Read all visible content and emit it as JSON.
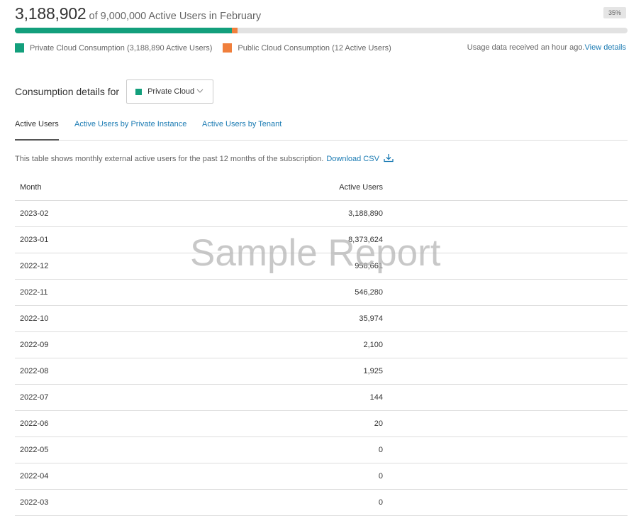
{
  "header": {
    "active_count": "3,188,902",
    "summary": "of 9,000,000 Active Users in February",
    "percent_badge": "35%"
  },
  "progress": {
    "private_fraction": 0.3543,
    "public_fraction": 0.0095,
    "private_color": "#139f7c",
    "public_color": "#f07f3c"
  },
  "legend": {
    "private_label": "Private Cloud Consumption (3,188,890 Active Users)",
    "public_label": "Public Cloud Consumption (12 Active Users)"
  },
  "usage": {
    "note": "Usage data received an hour ago.",
    "link": "View details"
  },
  "consumption": {
    "title": "Consumption details for",
    "selected": "Private Cloud"
  },
  "tabs": [
    {
      "label": "Active Users",
      "active": true
    },
    {
      "label": "Active Users by Private Instance",
      "active": false
    },
    {
      "label": "Active Users by Tenant",
      "active": false
    }
  ],
  "description": {
    "text": "This table shows monthly external active users for the past 12 months of the subscription.",
    "download_label": "Download CSV"
  },
  "table": {
    "columns": [
      "Month",
      "Active Users"
    ],
    "rows": [
      [
        "2023-02",
        "3,188,890"
      ],
      [
        "2023-01",
        "8,373,624"
      ],
      [
        "2022-12",
        "958,661"
      ],
      [
        "2022-11",
        "546,280"
      ],
      [
        "2022-10",
        "35,974"
      ],
      [
        "2022-09",
        "2,100"
      ],
      [
        "2022-08",
        "1,925"
      ],
      [
        "2022-07",
        "144"
      ],
      [
        "2022-06",
        "20"
      ],
      [
        "2022-05",
        "0"
      ],
      [
        "2022-04",
        "0"
      ],
      [
        "2022-03",
        "0"
      ]
    ]
  },
  "watermark": "Sample Report"
}
